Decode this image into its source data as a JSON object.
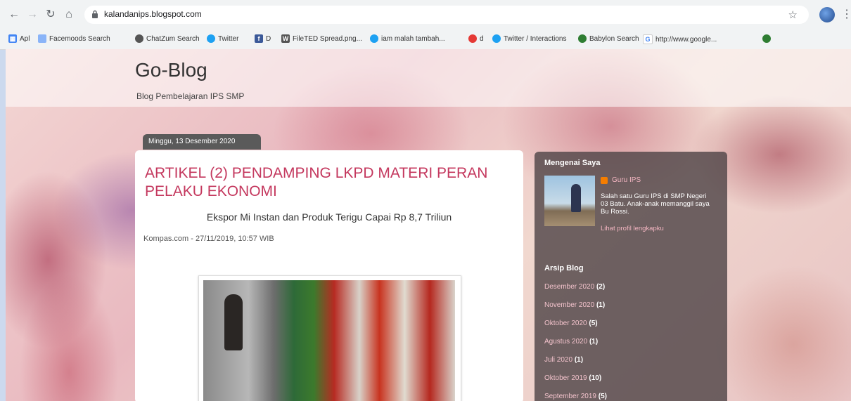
{
  "browser": {
    "url": "kalandanips.blogspot.com",
    "bookmarks": [
      "Apl",
      "Facemoods Search",
      "ChatZum Search",
      "Twitter",
      "D",
      "FileTED Spread.png...",
      "iam malah tambah...",
      "d",
      "Twitter / Interactions",
      "Babylon Search",
      "http://www.google..."
    ]
  },
  "blog": {
    "title": "Go-Blog",
    "description": "Blog Pembelajaran IPS SMP"
  },
  "post": {
    "date": "Minggu, 13 Desember 2020",
    "title": "ARTIKEL (2) PENDAMPING LKPD MATERI PERAN PELAKU EKONOMI",
    "subtitle": "Ekspor Mi Instan dan Produk Terigu Capai Rp 8,7 Triliun",
    "meta": "Kompas.com - 27/11/2019, 10:57 WIB"
  },
  "sidebar": {
    "about_heading": "Mengenai Saya",
    "profile_name": "Guru IPS",
    "profile_desc": "Salah satu Guru IPS di SMP Negeri 03 Batu. Anak-anak memanggil saya Bu Rossi.",
    "profile_link": "Lihat profil lengkapku",
    "archive_heading": "Arsip Blog",
    "archive": [
      {
        "label": "Desember 2020",
        "count": "(2)"
      },
      {
        "label": "November 2020",
        "count": "(1)"
      },
      {
        "label": "Oktober 2020",
        "count": "(5)"
      },
      {
        "label": "Agustus 2020",
        "count": "(1)"
      },
      {
        "label": "Juli 2020",
        "count": "(1)"
      },
      {
        "label": "Oktober 2019",
        "count": "(10)"
      },
      {
        "label": "September 2019",
        "count": "(5)"
      }
    ]
  }
}
